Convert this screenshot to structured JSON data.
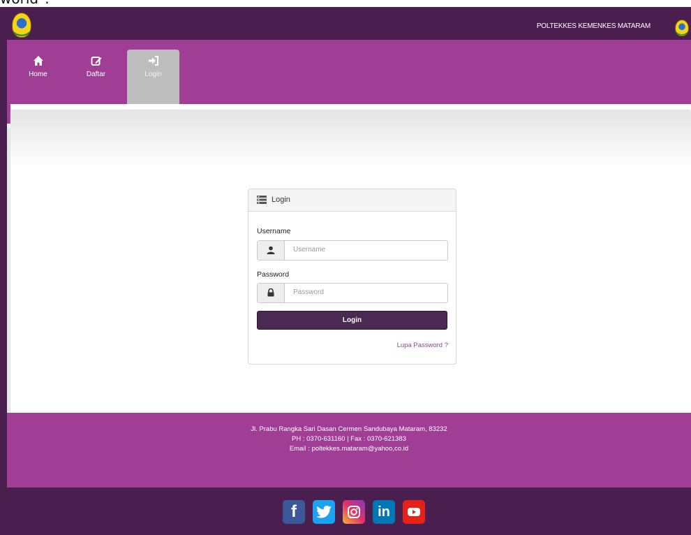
{
  "top_partial_text": "world\".",
  "header": {
    "title": "POLTEKKES KEMENKES MATARAM",
    "logo_icon": "poltekkes-emblem-icon"
  },
  "nav": {
    "items": [
      {
        "label": "Home",
        "icon": "home-icon"
      },
      {
        "label": "Daftar",
        "icon": "edit-icon"
      },
      {
        "label": "Login",
        "icon": "sign-in-icon",
        "active": true
      }
    ]
  },
  "login_panel": {
    "title": "Login",
    "username_label": "Username",
    "username_placeholder": "Username",
    "username_value": "",
    "password_label": "Password",
    "password_placeholder": "Password",
    "password_value": "",
    "button_label": "Login",
    "forgot_link": "Lupa Password ?"
  },
  "footer": {
    "address": "Jl. Prabu Rangka Sari Dasan Cermen Sandubaya Mataram, 83232",
    "phone_fax": "PH : 0370-631160 | Fax : 0370-621383",
    "email": "Email : poltekkes.mataram@yahoo,co.id"
  },
  "social": [
    {
      "name": "facebook",
      "label": "f"
    },
    {
      "name": "twitter"
    },
    {
      "name": "instagram"
    },
    {
      "name": "linkedin",
      "label": "in"
    },
    {
      "name": "youtube"
    }
  ],
  "colors": {
    "topbar": "#4a1f4f",
    "navbar": "#a03e95",
    "button": "#4a2a52",
    "active_tab": "#bdbdbd"
  }
}
